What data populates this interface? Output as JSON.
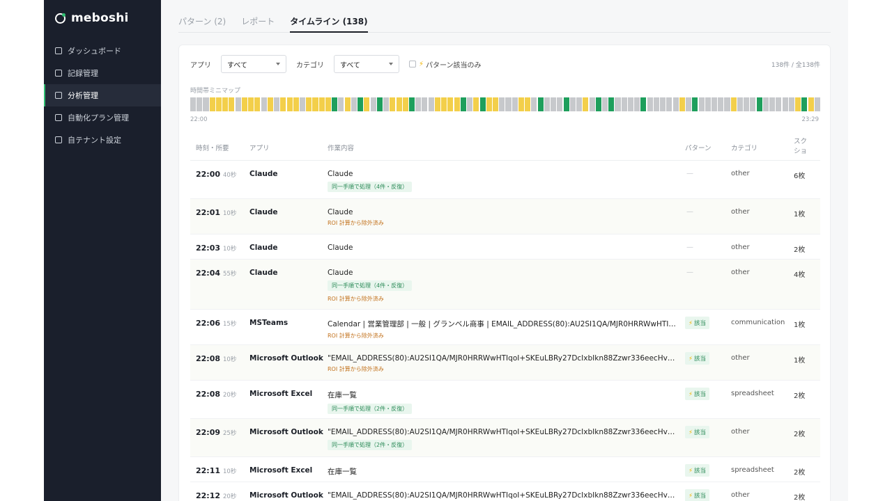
{
  "app": {
    "name": "meboshi"
  },
  "sidebar": {
    "items": [
      {
        "label": "ダッシュボード",
        "active": false
      },
      {
        "label": "記録管理",
        "active": false
      },
      {
        "label": "分析管理",
        "active": true
      },
      {
        "label": "自動化プラン管理",
        "active": false
      },
      {
        "label": "自テナント設定",
        "active": false
      }
    ]
  },
  "tabs": [
    {
      "label": "パターン (2)",
      "active": false
    },
    {
      "label": "レポート",
      "active": false
    },
    {
      "label": "タイムライン (138)",
      "active": true
    }
  ],
  "filters": {
    "app_label": "アプリ",
    "app_value": "すべて",
    "category_label": "カテゴリ",
    "category_value": "すべて",
    "pattern_only_label": "パターン該当のみ",
    "pattern_only_checked": false,
    "count_text": "138件 / 全138件"
  },
  "minimap": {
    "label": "時間帯ミニマップ",
    "start": "22:00",
    "end": "23:29",
    "colors": {
      "g": "#c7c9cc",
      "y": "#f3cf4a",
      "n": "#1e9f5c"
    },
    "segments": "gggyyyygyyygygyyygyyyyngygnygngyyyngggyyyyngynyygggyygngggnggygngnggggngggggygngggggygggngggggynyg"
  },
  "table": {
    "headers": {
      "time": "時刻・所要",
      "app": "アプリ",
      "work": "作業内容",
      "pattern": "パターン",
      "category": "カテゴリ",
      "shots": "スクショ"
    },
    "rows": [
      {
        "time": "22:00",
        "duration": "40秒",
        "app": "Claude",
        "work": "Claude",
        "badge": "同一手順で処理（4件・反復）",
        "roi": "",
        "pattern": "—",
        "category": "other",
        "shots": "6枚"
      },
      {
        "time": "22:01",
        "duration": "10秒",
        "app": "Claude",
        "work": "Claude",
        "badge": "",
        "roi": "ROI 計算から除外済み",
        "pattern": "—",
        "category": "other",
        "shots": "1枚"
      },
      {
        "time": "22:03",
        "duration": "10秒",
        "app": "Claude",
        "work": "Claude",
        "badge": "",
        "roi": "",
        "pattern": "—",
        "category": "other",
        "shots": "2枚"
      },
      {
        "time": "22:04",
        "duration": "55秒",
        "app": "Claude",
        "work": "Claude",
        "badge": "同一手順で処理（4件・反復）",
        "roi": "ROI 計算から除外済み",
        "pattern": "—",
        "category": "other",
        "shots": "4枚"
      },
      {
        "time": "22:06",
        "duration": "15秒",
        "app": "MSTeams",
        "work": "Calendar | 営業管理部 | 一般 | グランベル商事 | EMAIL_ADDRESS(80):AU2SI1QA/MJR0HRRWwHTIqoI+S…",
        "badge": "",
        "roi": "ROI 計算から除外済み",
        "pattern": "該当",
        "category": "communication",
        "shots": "1枚"
      },
      {
        "time": "22:08",
        "duration": "10秒",
        "app": "Microsoft Outlook",
        "work": "\"EMAIL_ADDRESS(80):AU2SI1QA/MJR0HRRWwHTIqoI+SKEuLBRy27DcIxbIkn88Zzwr336eecHvOl…\" …",
        "badge": "",
        "roi": "ROI 計算から除外済み",
        "pattern": "該当",
        "category": "other",
        "shots": "1枚"
      },
      {
        "time": "22:08",
        "duration": "20秒",
        "app": "Microsoft Excel",
        "work": "在庫一覧",
        "badge": "同一手順で処理（2件・反復）",
        "roi": "",
        "pattern": "該当",
        "category": "spreadsheet",
        "shots": "2枚"
      },
      {
        "time": "22:09",
        "duration": "25秒",
        "app": "Microsoft Outlook",
        "work": "\"EMAIL_ADDRESS(80):AU2SI1QA/MJR0HRRWwHTIqoI+SKEuLBRy27DcIxbIkn88Zzwr336eecHvOl…\" …",
        "badge": "同一手順で処理（2件・反復）",
        "roi": "",
        "pattern": "該当",
        "category": "other",
        "shots": "2枚"
      },
      {
        "time": "22:11",
        "duration": "10秒",
        "app": "Microsoft Excel",
        "work": "在庫一覧",
        "badge": "",
        "roi": "",
        "pattern": "該当",
        "category": "spreadsheet",
        "shots": "2枚"
      },
      {
        "time": "22:12",
        "duration": "20秒",
        "app": "Microsoft Outlook",
        "work": "\"EMAIL_ADDRESS(80):AU2SI1QA/MJR0HRRWwHTIqoI+SKEuLBRy27DcIxbIkn88Zzwr336eecHvOl…\" …",
        "badge": "",
        "roi": "",
        "pattern": "該当",
        "category": "other",
        "shots": "2枚"
      }
    ]
  }
}
